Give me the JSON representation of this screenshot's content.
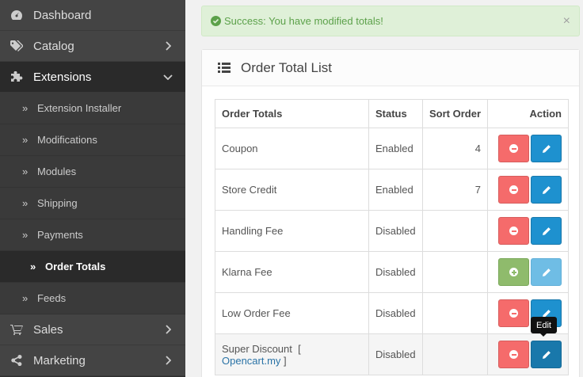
{
  "sidebar": {
    "items": [
      {
        "label": "Dashboard",
        "icon": "dashboard-icon"
      },
      {
        "label": "Catalog",
        "icon": "tags-icon"
      },
      {
        "label": "Extensions",
        "icon": "puzzle-icon"
      },
      {
        "label": "Extension Installer"
      },
      {
        "label": "Modifications"
      },
      {
        "label": "Modules"
      },
      {
        "label": "Shipping"
      },
      {
        "label": "Payments"
      },
      {
        "label": "Order Totals"
      },
      {
        "label": "Feeds"
      },
      {
        "label": "Sales",
        "icon": "cart-icon"
      },
      {
        "label": "Marketing",
        "icon": "share-icon"
      }
    ]
  },
  "alert": {
    "text": "Success: You have modified totals!",
    "close": "×"
  },
  "panel": {
    "title": "Order Total List"
  },
  "table": {
    "headers": [
      "Order Totals",
      "Status",
      "Sort Order",
      "Action"
    ],
    "rows": [
      {
        "name": "Coupon",
        "status": "Enabled",
        "sort": "4"
      },
      {
        "name": "Store Credit",
        "status": "Enabled",
        "sort": "7"
      },
      {
        "name": "Handling Fee",
        "status": "Disabled",
        "sort": ""
      },
      {
        "name": "Klarna Fee",
        "status": "Disabled",
        "sort": ""
      },
      {
        "name": "Low Order Fee",
        "status": "Disabled",
        "sort": ""
      },
      {
        "name": "Super Discount",
        "link": "Opencart.my",
        "status": "Disabled",
        "sort": ""
      }
    ]
  },
  "tooltip": {
    "text": "Edit"
  },
  "colors": {
    "success": "#5ca14a",
    "danger": "#f56b6b",
    "primary": "#1e91cf",
    "install": "#8fbb6c"
  }
}
